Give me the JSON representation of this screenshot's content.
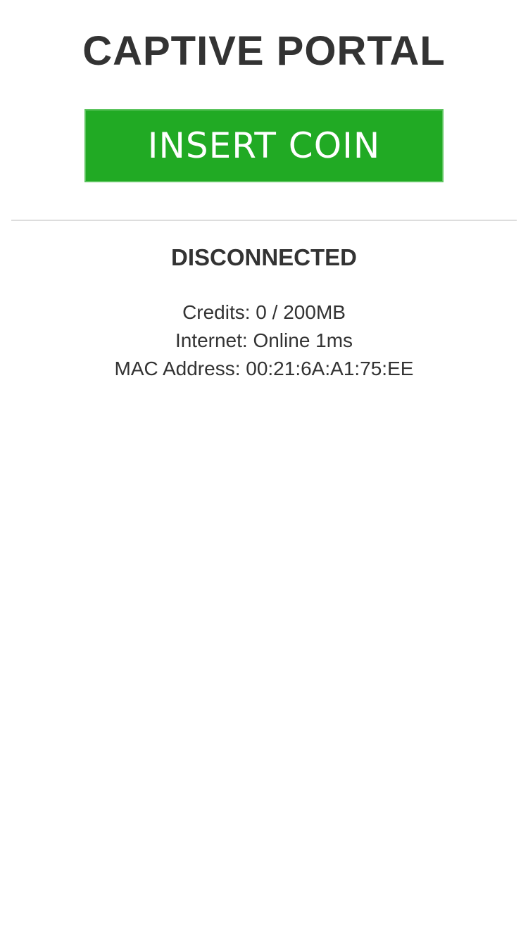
{
  "header": {
    "title": "CAPTIVE PORTAL"
  },
  "actions": {
    "insert_coin_label": "INSERT COIN",
    "button_color": "#21aa24"
  },
  "status": {
    "connection": "DISCONNECTED"
  },
  "info": {
    "credits": "Credits: 0 / 200MB",
    "internet": "Internet: Online 1ms",
    "mac_address": "MAC Address: 00:21:6A:A1:75:EE"
  }
}
